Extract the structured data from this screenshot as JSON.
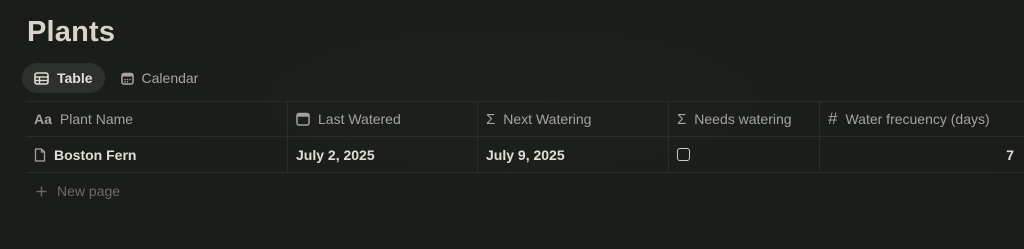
{
  "page": {
    "title": "Plants"
  },
  "tabs": [
    {
      "label": "Table",
      "icon": "table-icon",
      "active": true
    },
    {
      "label": "Calendar",
      "icon": "calendar-icon",
      "active": false
    }
  ],
  "table": {
    "columns": [
      {
        "label": "Plant Name",
        "icon": "text-property-icon",
        "icon_glyph": "Aa"
      },
      {
        "label": "Last Watered",
        "icon": "calendar-icon"
      },
      {
        "label": "Next Watering",
        "icon": "formula-icon",
        "icon_glyph": "Σ"
      },
      {
        "label": "Needs watering",
        "icon": "formula-icon",
        "icon_glyph": "Σ"
      },
      {
        "label": "Water frecuency (days)",
        "icon": "number-icon",
        "icon_glyph": "#"
      }
    ],
    "rows": [
      {
        "plant_name": "Boston Fern",
        "last_watered": "July 2, 2025",
        "next_watering": "July 9, 2025",
        "needs_watering": false,
        "water_frequency": "7"
      }
    ],
    "new_page_label": "New page",
    "new_page_icon": "plus-icon"
  },
  "colors": {
    "background": "#1a1d18",
    "text": "#e0ddd6",
    "muted_text": "#a6a29b",
    "active_tab_bg": "#2e302b"
  }
}
